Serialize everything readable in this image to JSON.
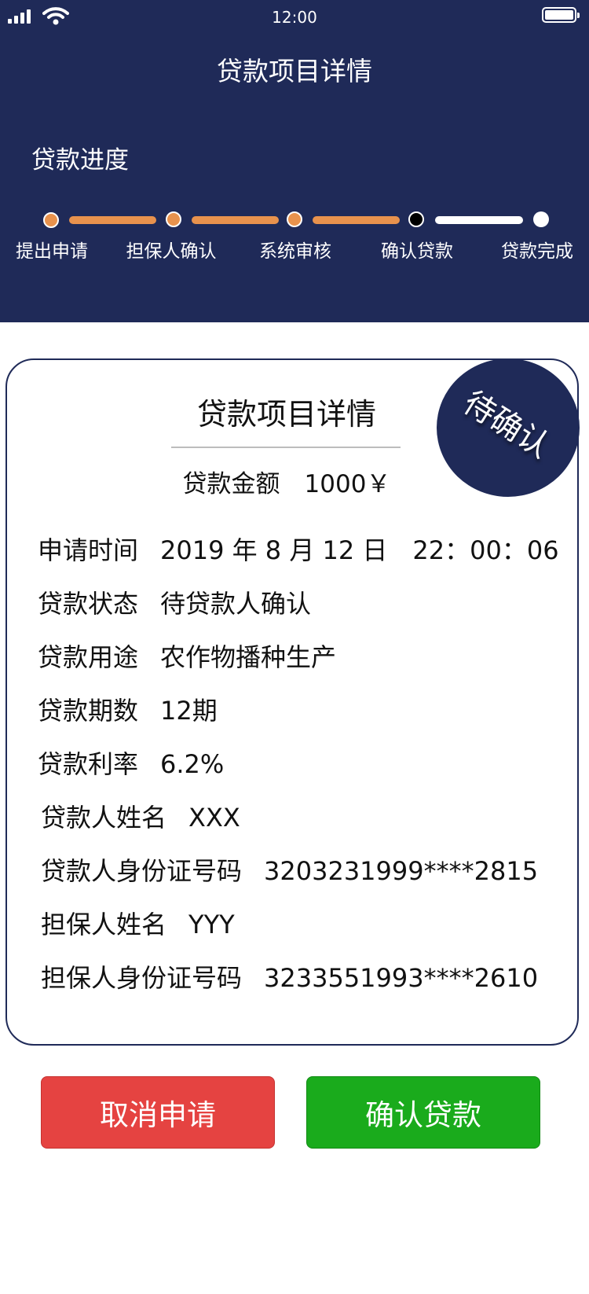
{
  "status_bar": {
    "time": "12:00"
  },
  "header": {
    "title": "贷款项目详情",
    "progress_label": "贷款进度",
    "steps": [
      {
        "label": "提出申请",
        "state": "done"
      },
      {
        "label": "担保人确认",
        "state": "done"
      },
      {
        "label": "系统审核",
        "state": "done"
      },
      {
        "label": "确认贷款",
        "state": "current"
      },
      {
        "label": "贷款完成",
        "state": "pending"
      }
    ]
  },
  "card": {
    "title": "贷款项目详情",
    "badge": "待确认",
    "amount": "贷款金额　1000￥",
    "rows": [
      {
        "label": "申请时间",
        "value": "2019 年 8 月 12 日　22：00：06"
      },
      {
        "label": "贷款状态",
        "value": "待贷款人确认"
      },
      {
        "label": "贷款用途",
        "value": "农作物播种生产"
      },
      {
        "label": "贷款期数",
        "value": "12期"
      },
      {
        "label": "贷款利率",
        "value": "6.2%"
      },
      {
        "label": "贷款人姓名",
        "value": "XXX"
      },
      {
        "label": "贷款人身份证号码",
        "value": "3203231999****2815"
      },
      {
        "label": "担保人姓名",
        "value": "YYY"
      },
      {
        "label": "担保人身份证号码",
        "value": "3233551993****2610"
      }
    ]
  },
  "actions": {
    "cancel": "取消申请",
    "confirm": "确认贷款"
  },
  "colors": {
    "header_bg": "#1f2a58",
    "progress_done": "#e8924d",
    "cancel_button": "#e54341",
    "confirm_button": "#1aab1c"
  }
}
